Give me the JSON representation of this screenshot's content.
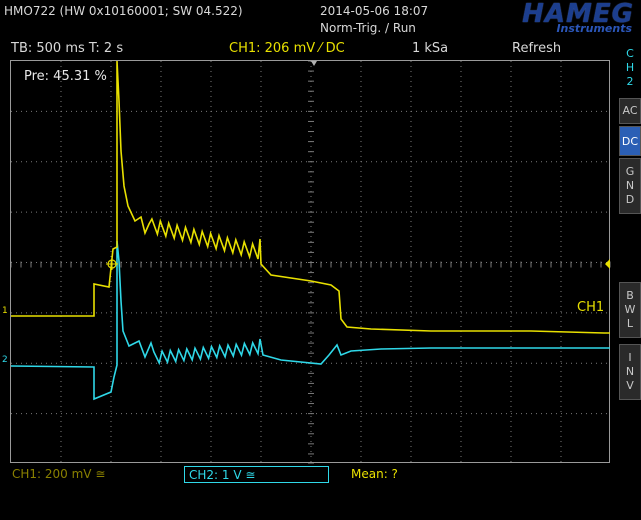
{
  "header": {
    "title": "HMO722 (HW 0x10160001; SW 04.522)",
    "datetime": "2014-05-06 18:07",
    "trigger_mode": "Norm-Trig. / Run",
    "logo_brand": "HAMEG",
    "logo_sub": "Instruments"
  },
  "status": {
    "timebase": "TB: 500 ms  T: 2 s",
    "ch1_trigger": "CH1: 206 mV ⁄ DC",
    "sample_rate": "1 kSa",
    "refresh": "Refresh"
  },
  "screen": {
    "pretrigger": "Pre: 45.31 %",
    "ch1_label": "CH1",
    "ch1_marker": "1",
    "ch2_marker": "2"
  },
  "side_menu": {
    "channel": "C\nH\n2",
    "ac": "AC",
    "dc": "DC",
    "gnd": "G\nN\nD",
    "bwl": "B\nW\nL",
    "inv": "I\nN\nV"
  },
  "bottom": {
    "ch1_scale": "CH1: 200 mV ≅",
    "ch2_scale": "CH2: 1 V ≅",
    "measurement": "Mean: ?"
  },
  "colors": {
    "ch1": "#e8e000",
    "ch2": "#2fd8e8",
    "grid": "#7a7a7a",
    "selected_tab": "#2b5fb5"
  }
}
